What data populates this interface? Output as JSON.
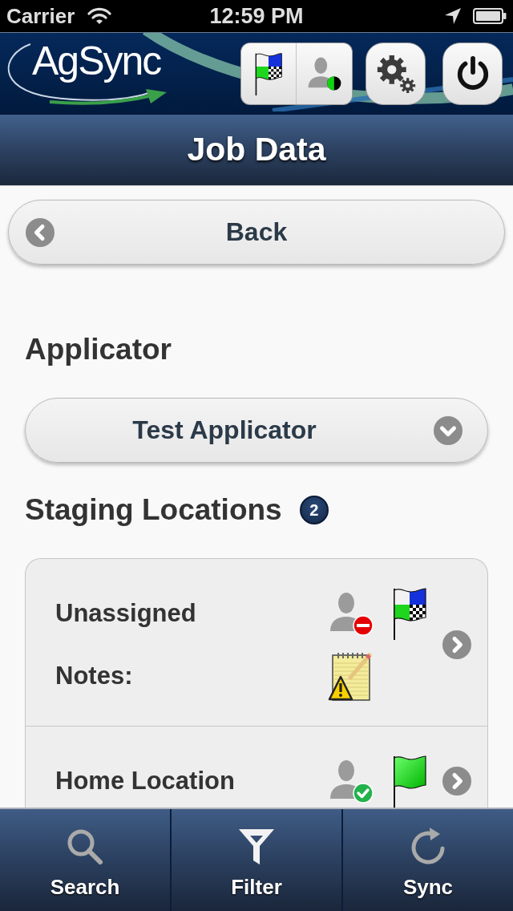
{
  "status_bar": {
    "carrier": "Carrier",
    "time": "12:59 PM"
  },
  "header": {
    "logo_text": "AgSync"
  },
  "title": "Job Data",
  "back_button": {
    "label": "Back"
  },
  "applicator": {
    "heading": "Applicator",
    "value": "Test Applicator"
  },
  "staging_locations": {
    "heading": "Staging Locations",
    "count": "2",
    "items": [
      {
        "name": "Unassigned",
        "assigned": false,
        "flag_checkered": true,
        "notes": {
          "label": "Notes:",
          "warning": true
        }
      },
      {
        "name": "Home Location",
        "assigned": true,
        "flag_checkered": false
      }
    ]
  },
  "tab_bar": [
    {
      "kind": "search",
      "label": "Search",
      "active": false
    },
    {
      "kind": "filter",
      "label": "Filter",
      "active": true
    },
    {
      "kind": "sync",
      "label": "Sync",
      "active": false
    }
  ]
}
